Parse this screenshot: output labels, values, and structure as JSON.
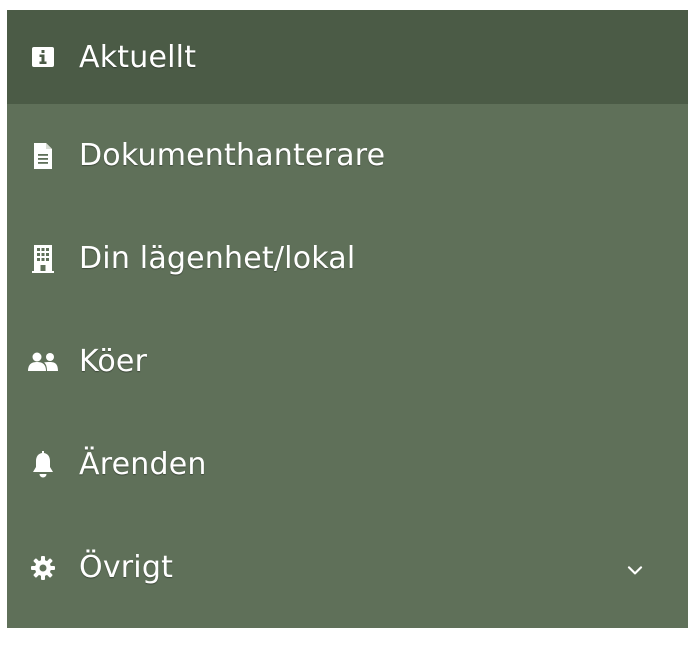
{
  "menu": {
    "items": [
      {
        "label": "Aktuellt",
        "icon": "info-icon",
        "active": true
      },
      {
        "label": "Dokumenthanterare",
        "icon": "document-icon",
        "active": false
      },
      {
        "label": "Din lägenhet/lokal",
        "icon": "building-icon",
        "active": false
      },
      {
        "label": "Köer",
        "icon": "users-icon",
        "active": false
      },
      {
        "label": "Ärenden",
        "icon": "bell-icon",
        "active": false
      },
      {
        "label": "Övrigt",
        "icon": "gear-icon",
        "active": false,
        "expandable": true
      }
    ]
  },
  "colors": {
    "menu_background": "#5f7059",
    "active_background": "#4b5b46",
    "text": "#ffffff"
  }
}
